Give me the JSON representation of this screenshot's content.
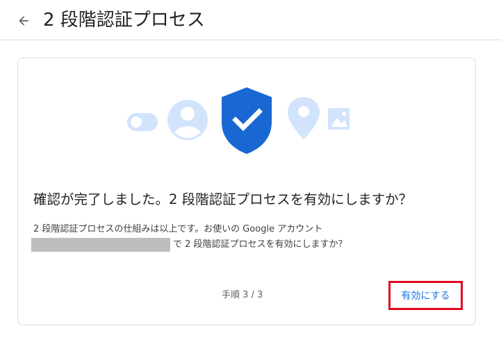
{
  "header": {
    "back_icon": "arrow-back-icon",
    "title": "2 段階認証プロセス"
  },
  "card": {
    "illustration_icons": [
      "toggle-icon",
      "account-circle-icon",
      "shield-check-icon",
      "location-pin-icon",
      "image-icon"
    ],
    "heading": "確認が完了しました。2 段階認証プロセスを有効にしますか？",
    "description_line1": "2 段階認証プロセスの仕組みは以上です。お使いの Google アカウント",
    "description_line2": "で 2 段階認証プロセスを有効にしますか？",
    "step": "手順 3 / 3",
    "enable_label": "有効にする"
  },
  "colors": {
    "accent_blue": "#1a73e8",
    "shield_blue": "#1967d2",
    "illustration_light_blue": "#d2e3fc",
    "highlight_red": "#e0061f"
  }
}
